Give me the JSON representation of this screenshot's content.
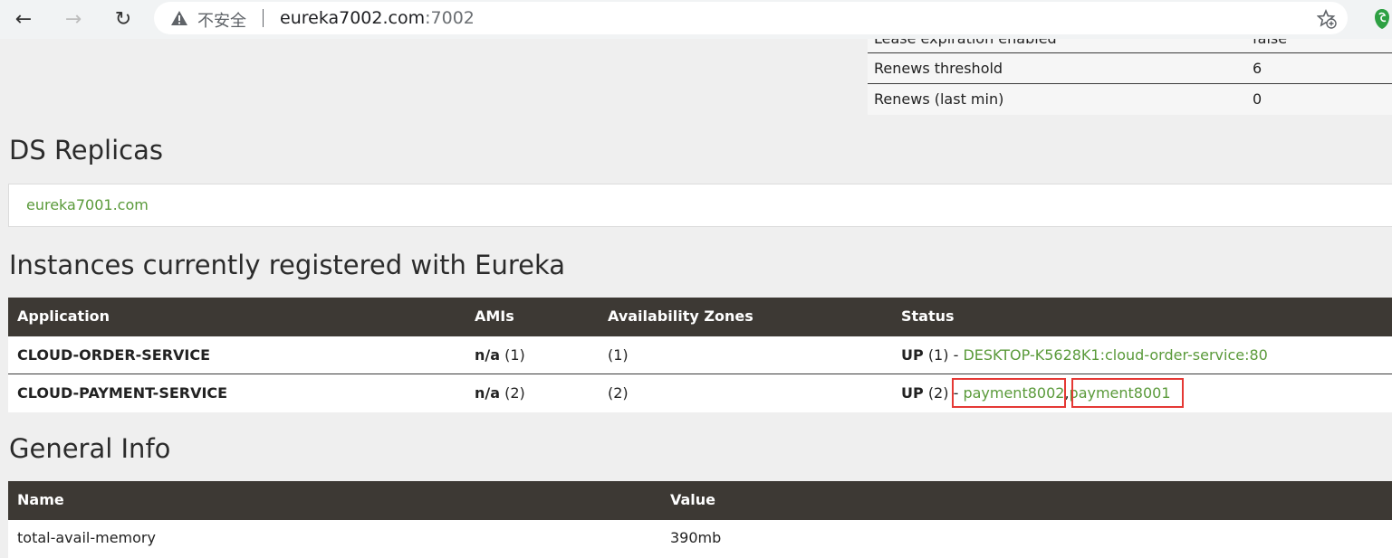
{
  "browser": {
    "security_label": "不安全",
    "url_host": "eureka7002.com",
    "url_port": ":7002",
    "icons": [
      "back-arrow-icon",
      "forward-arrow-icon",
      "reload-icon",
      "warning-icon",
      "bookmark-star-icon",
      "extension-icon"
    ]
  },
  "stats": {
    "cut_row": {
      "key": "Lease expiration enabled",
      "value": "false"
    },
    "rows": [
      {
        "key": "Renews threshold",
        "value": "6"
      },
      {
        "key": "Renews (last min)",
        "value": "0"
      }
    ]
  },
  "replicas": {
    "heading": "DS Replicas",
    "items": [
      "eureka7001.com"
    ]
  },
  "instances": {
    "heading": "Instances currently registered with Eureka",
    "columns": [
      "Application",
      "AMIs",
      "Availability Zones",
      "Status"
    ],
    "rows": [
      {
        "application": "CLOUD-ORDER-SERVICE",
        "amis_label": "n/a",
        "amis_count": "(1)",
        "zones": "(1)",
        "status_label": "UP",
        "status_count": "(1)",
        "status_sep": " - ",
        "links": [
          "DESKTOP-K5628K1:cloud-order-service:80"
        ]
      },
      {
        "application": "CLOUD-PAYMENT-SERVICE",
        "amis_label": "n/a",
        "amis_count": "(2)",
        "zones": "(2)",
        "status_label": "UP",
        "status_count": "(2)",
        "status_sep": " - ",
        "link_sep": ",",
        "links": [
          "payment8002",
          "payment8001"
        ]
      }
    ]
  },
  "general_info": {
    "heading": "General Info",
    "columns": [
      "Name",
      "Value"
    ],
    "rows": [
      {
        "name": "total-avail-memory",
        "value": "390mb"
      }
    ]
  },
  "colors": {
    "link": "#5a9a3a",
    "table_header_bg": "#3d3934",
    "highlight_box": "#e53935"
  }
}
